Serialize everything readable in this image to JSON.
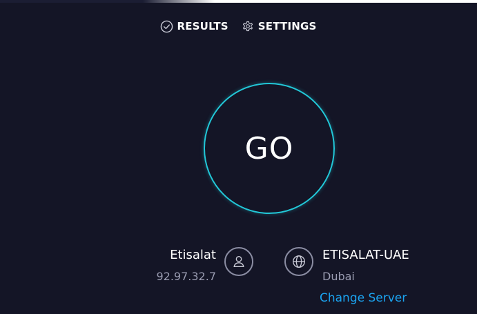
{
  "nav": {
    "results_label": "RESULTS",
    "settings_label": "SETTINGS"
  },
  "main": {
    "go_label": "GO"
  },
  "isp": {
    "name": "Etisalat",
    "ip": "92.97.32.7"
  },
  "server": {
    "name": "ETISALAT-UAE",
    "location": "Dubai",
    "change_label": "Change Server"
  },
  "colors": {
    "background": "#141526",
    "accent_ring": "#22c8d8",
    "link": "#1ba3ef",
    "muted_text": "#9a9cb1"
  },
  "icons": [
    "check-circle-icon",
    "gear-icon",
    "user-icon",
    "globe-icon"
  ]
}
